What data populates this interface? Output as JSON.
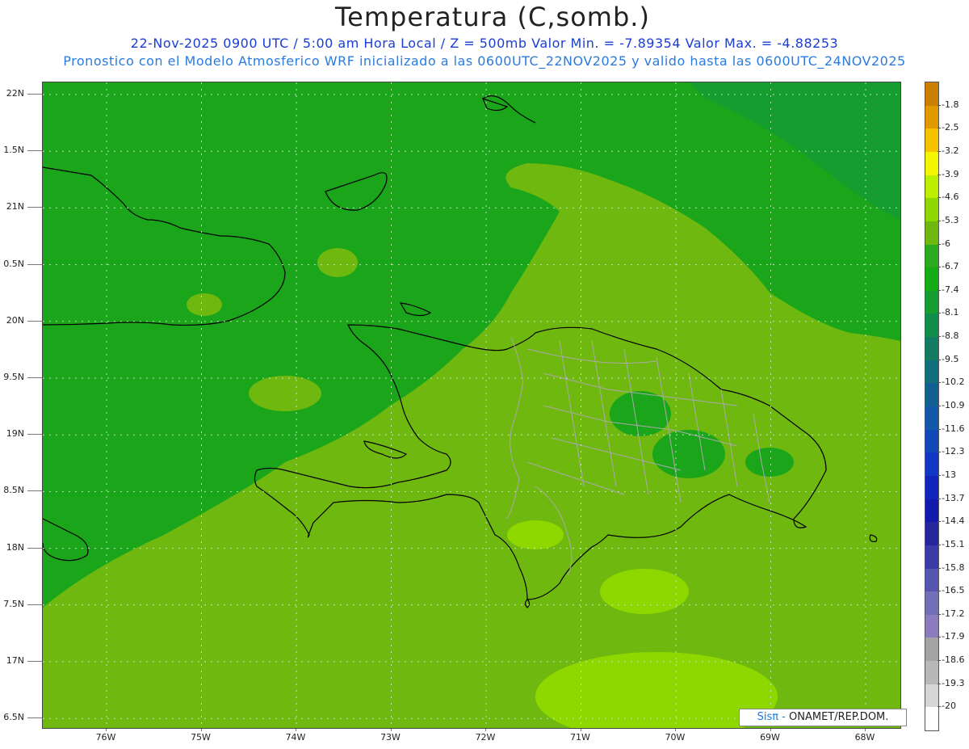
{
  "header": {
    "title": "Temperatura (C,somb.)",
    "line1": "22-Nov-2025  0900 UTC / 5:00 am Hora Local / Z = 500mb  Valor Min. = -7.89354  Valor Max. = -4.88253",
    "line2": "Pronostico con el Modelo Atmosferico WRF inicializado a las 0600UTC_22NOV2025 y valido hasta las  0600UTC_24NOV2025"
  },
  "axes": {
    "lat_labels": [
      "22N",
      "1.5N",
      "21N",
      "0.5N",
      "20N",
      "9.5N",
      "19N",
      "8.5N",
      "18N",
      "7.5N",
      "17N",
      "6.5N"
    ],
    "lon_labels": [
      "76W",
      "75W",
      "74W",
      "73W",
      "72W",
      "71W",
      "70W",
      "69W",
      "68W"
    ]
  },
  "legend": {
    "labels": [
      "-1.8",
      "-2.5",
      "-3.2",
      "-3.9",
      "-4.6",
      "-5.3",
      "-6",
      "-6.7",
      "-7.4",
      "-8.1",
      "-8.8",
      "-9.5",
      "-10.2",
      "-10.9",
      "-11.6",
      "-12.3",
      "-13",
      "-13.7",
      "-14.4",
      "-15.1",
      "-15.8",
      "-16.5",
      "-17.2",
      "-17.9",
      "-18.6",
      "-19.3",
      "-20"
    ],
    "colors": [
      "#c97f00",
      "#e09a00",
      "#f5c200",
      "#f5f500",
      "#bdf000",
      "#8ed800",
      "#6fb810",
      "#2aaa1e",
      "#13ad13",
      "#159d30",
      "#128c4a",
      "#127c62",
      "#126d7c",
      "#125f92",
      "#1257aa",
      "#1247b8",
      "#1236c4",
      "#1224bc",
      "#121aac",
      "#25259e",
      "#3b3ba8",
      "#5656b0",
      "#7070b8",
      "#8d7cbd",
      "#a4a4a4",
      "#b8b8b8",
      "#d6d6d6",
      "#ffffff"
    ]
  },
  "map": {
    "field_colors": {
      "base": "#1aa51a",
      "band": "#6fb810",
      "warm": "#8ed800",
      "cold": "#159d30"
    }
  },
  "credit": {
    "brand": "Sisπ -",
    "org": "ONAMET/REP.DOM."
  }
}
